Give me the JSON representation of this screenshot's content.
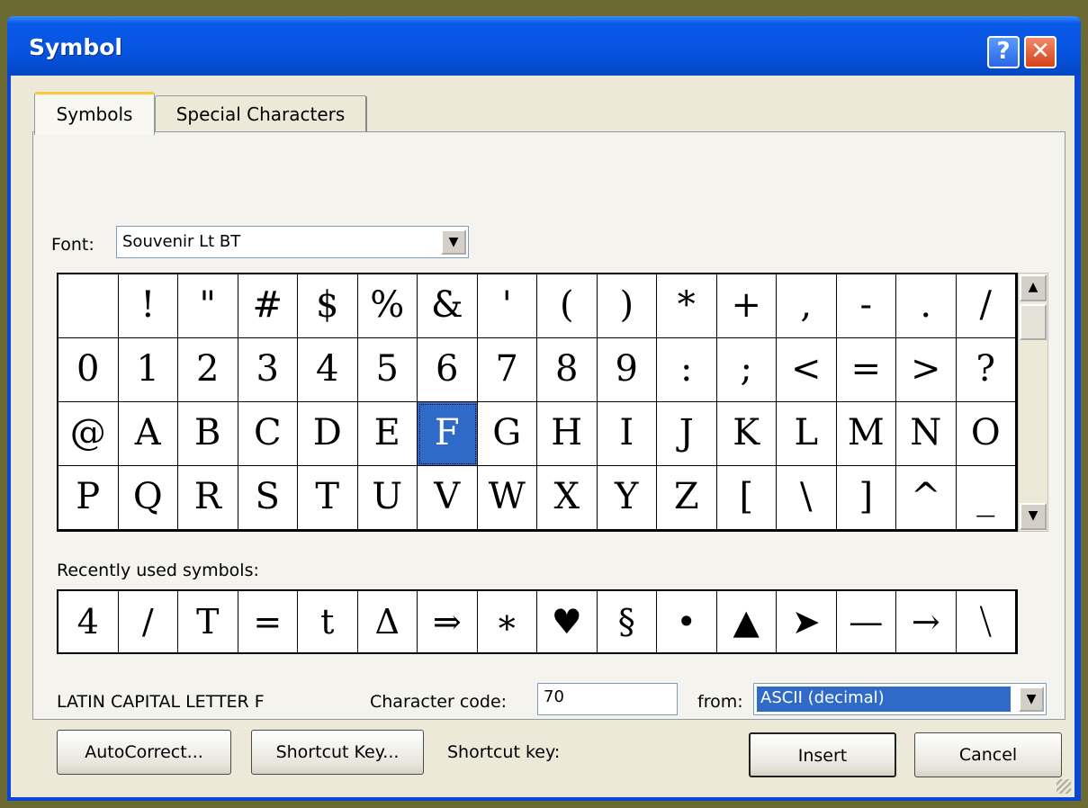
{
  "window": {
    "title": "Symbol",
    "help_label": "?",
    "close_label": "✕"
  },
  "tabs": [
    {
      "label": "Symbols",
      "active": true
    },
    {
      "label": "Special Characters",
      "active": false
    }
  ],
  "font": {
    "label": "Font:",
    "value": "Souvenir Lt BT"
  },
  "grid": {
    "selected": "F",
    "rows": [
      [
        "",
        "!",
        "\"",
        "#",
        "$",
        "%",
        "&",
        "'",
        "(",
        ")",
        "*",
        "+",
        ",",
        "-",
        ".",
        "/"
      ],
      [
        "0",
        "1",
        "2",
        "3",
        "4",
        "5",
        "6",
        "7",
        "8",
        "9",
        ":",
        ";",
        "<",
        "=",
        ">",
        "?"
      ],
      [
        "@",
        "A",
        "B",
        "C",
        "D",
        "E",
        "F",
        "G",
        "H",
        "I",
        "J",
        "K",
        "L",
        "M",
        "N",
        "O"
      ],
      [
        "P",
        "Q",
        "R",
        "S",
        "T",
        "U",
        "V",
        "W",
        "X",
        "Y",
        "Z",
        "[",
        "\\",
        "]",
        "^",
        "_"
      ]
    ]
  },
  "recent": {
    "label": "Recently used symbols:",
    "symbols": [
      "4",
      "/",
      "T",
      "=",
      "t",
      "Δ",
      "⇒",
      "∗",
      "♥",
      "§",
      "•",
      "▲",
      "➤",
      "—",
      "→",
      "⧹"
    ]
  },
  "character_name": "LATIN CAPITAL LETTER F",
  "character_code": {
    "label": "Character code:",
    "value": "70"
  },
  "from": {
    "label": "from:",
    "value": "ASCII (decimal)"
  },
  "buttons": {
    "autocorrect": "AutoCorrect...",
    "shortcut_key": "Shortcut Key...",
    "shortcut_key_label": "Shortcut key:",
    "insert": "Insert",
    "cancel": "Cancel"
  }
}
